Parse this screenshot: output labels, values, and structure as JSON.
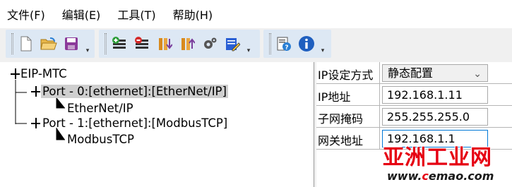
{
  "menubar": {
    "items": [
      "文件(F)",
      "编辑(E)",
      "工具(T)",
      "帮助(H)"
    ]
  },
  "toolbar": {
    "group1": [
      "new-file-icon",
      "open-folder-icon",
      "save-icon"
    ],
    "group2": [
      "add-device-icon",
      "remove-device-icon",
      "import-icon",
      "export-icon",
      "settings-gear-icon",
      "edit-icon"
    ],
    "group3": [
      "document-help-icon",
      "info-icon"
    ]
  },
  "tree": {
    "root": "EIP-MTC",
    "ports": [
      {
        "label": "Port - 0:[ethernet]:[EtherNet/IP]",
        "child": "EtherNet/IP",
        "selected": true
      },
      {
        "label": "Port - 1:[ethernet]:[ModbusTCP]",
        "child": "ModbusTCP",
        "selected": false
      }
    ]
  },
  "properties": {
    "ip_mode": {
      "label": "IP设定方式",
      "value": "静态配置"
    },
    "ip_address": {
      "label": "IP地址",
      "value": "192.168.1.11"
    },
    "subnet_mask": {
      "label": "子网掩码",
      "value": "255.255.255.0"
    },
    "gateway": {
      "label": "网关地址",
      "value": "192.168.1.1"
    }
  },
  "watermark": {
    "title": "亚洲工业网",
    "url_prefix": "www.",
    "url_accent": "c",
    "url_rest": "emao.com"
  },
  "colors": {
    "toolbar_bg": "#dde8f4",
    "selection": "#cfcfcf",
    "accent": "#0078d7",
    "watermark_red": "#e60012"
  }
}
